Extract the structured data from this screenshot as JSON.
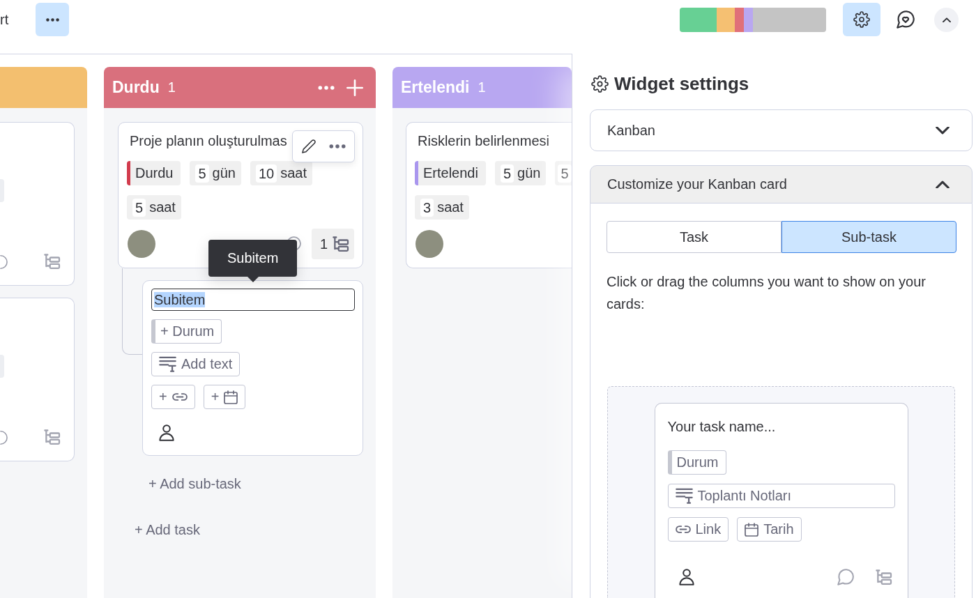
{
  "top_bar": {
    "cut_text": "rt",
    "more_active": true,
    "status_segments": [
      {
        "color": "#67d094"
      },
      {
        "color": "#f5c072"
      },
      {
        "color": "#e07079"
      },
      {
        "color": "#b9a7f1"
      },
      {
        "color": "#c4c4c4"
      }
    ],
    "settings_active": true
  },
  "board": {
    "columns": [
      {
        "color": "#f3bf6f",
        "hovered": false,
        "cards": [
          {
            "kind": "clipped"
          },
          {
            "kind": "clipped"
          }
        ]
      },
      {
        "title": "Durdu",
        "count": "1",
        "color": "#d9707d",
        "hovered": true,
        "cards": [
          {
            "kind": "full",
            "title": "Proje planın oluşturulmas",
            "chip_rows": [
              [
                {
                  "kind": "status",
                  "label": "Durdu",
                  "color": "#d23b4d"
                },
                {
                  "kind": "duration",
                  "value": "5",
                  "unit": "gün"
                },
                {
                  "kind": "duration",
                  "value": "10",
                  "unit": "saat"
                }
              ],
              [
                {
                  "kind": "duration",
                  "value": "5",
                  "unit": "saat"
                }
              ]
            ],
            "avatar": true,
            "comment_icon": true,
            "subitem_count": "1",
            "hover_toolbar": true,
            "tooltip": "Subitem"
          }
        ],
        "subitem_editor": {
          "name_value": "Subitem",
          "name_highlighted": true,
          "fields": [
            {
              "kind": "status",
              "label": "+ Durum"
            },
            {
              "kind": "text",
              "label": "Add text"
            },
            {
              "kind": "link",
              "prefix": "+"
            },
            {
              "kind": "date",
              "prefix": "+"
            }
          ]
        },
        "add_subtask": "+ Add sub-task",
        "add_task": "+ Add task"
      },
      {
        "title": "Ertelendi",
        "count": "1",
        "color": "#b8a7f1",
        "hovered": false,
        "cards": [
          {
            "kind": "full",
            "title": "Risklerin belirlenmesi",
            "chip_rows": [
              [
                {
                  "kind": "status",
                  "label": "Ertelendi",
                  "color": "#a996ee"
                },
                {
                  "kind": "duration",
                  "value": "5",
                  "unit": "gün"
                },
                {
                  "kind": "duration",
                  "value": "5"
                }
              ],
              [
                {
                  "kind": "duration",
                  "value": "3",
                  "unit": "saat"
                }
              ]
            ],
            "avatar": true
          }
        ]
      }
    ]
  },
  "panel": {
    "title": "Widget settings",
    "view_select": {
      "value": "Kanban"
    },
    "section": {
      "title": "Customize your Kanban card",
      "expanded": true,
      "tabs": [
        {
          "label": "Task",
          "selected": false
        },
        {
          "label": "Sub-task",
          "selected": true
        }
      ],
      "hint": "Click or drag the columns you want to show on your cards:",
      "preview": {
        "name": "Your task name...",
        "fields": [
          {
            "kind": "status",
            "label": "Durum"
          },
          {
            "kind": "text",
            "label": "Toplantı Notları"
          },
          {
            "kind": "link",
            "label": "Link"
          },
          {
            "kind": "date",
            "label": "Tarih"
          }
        ]
      }
    }
  }
}
